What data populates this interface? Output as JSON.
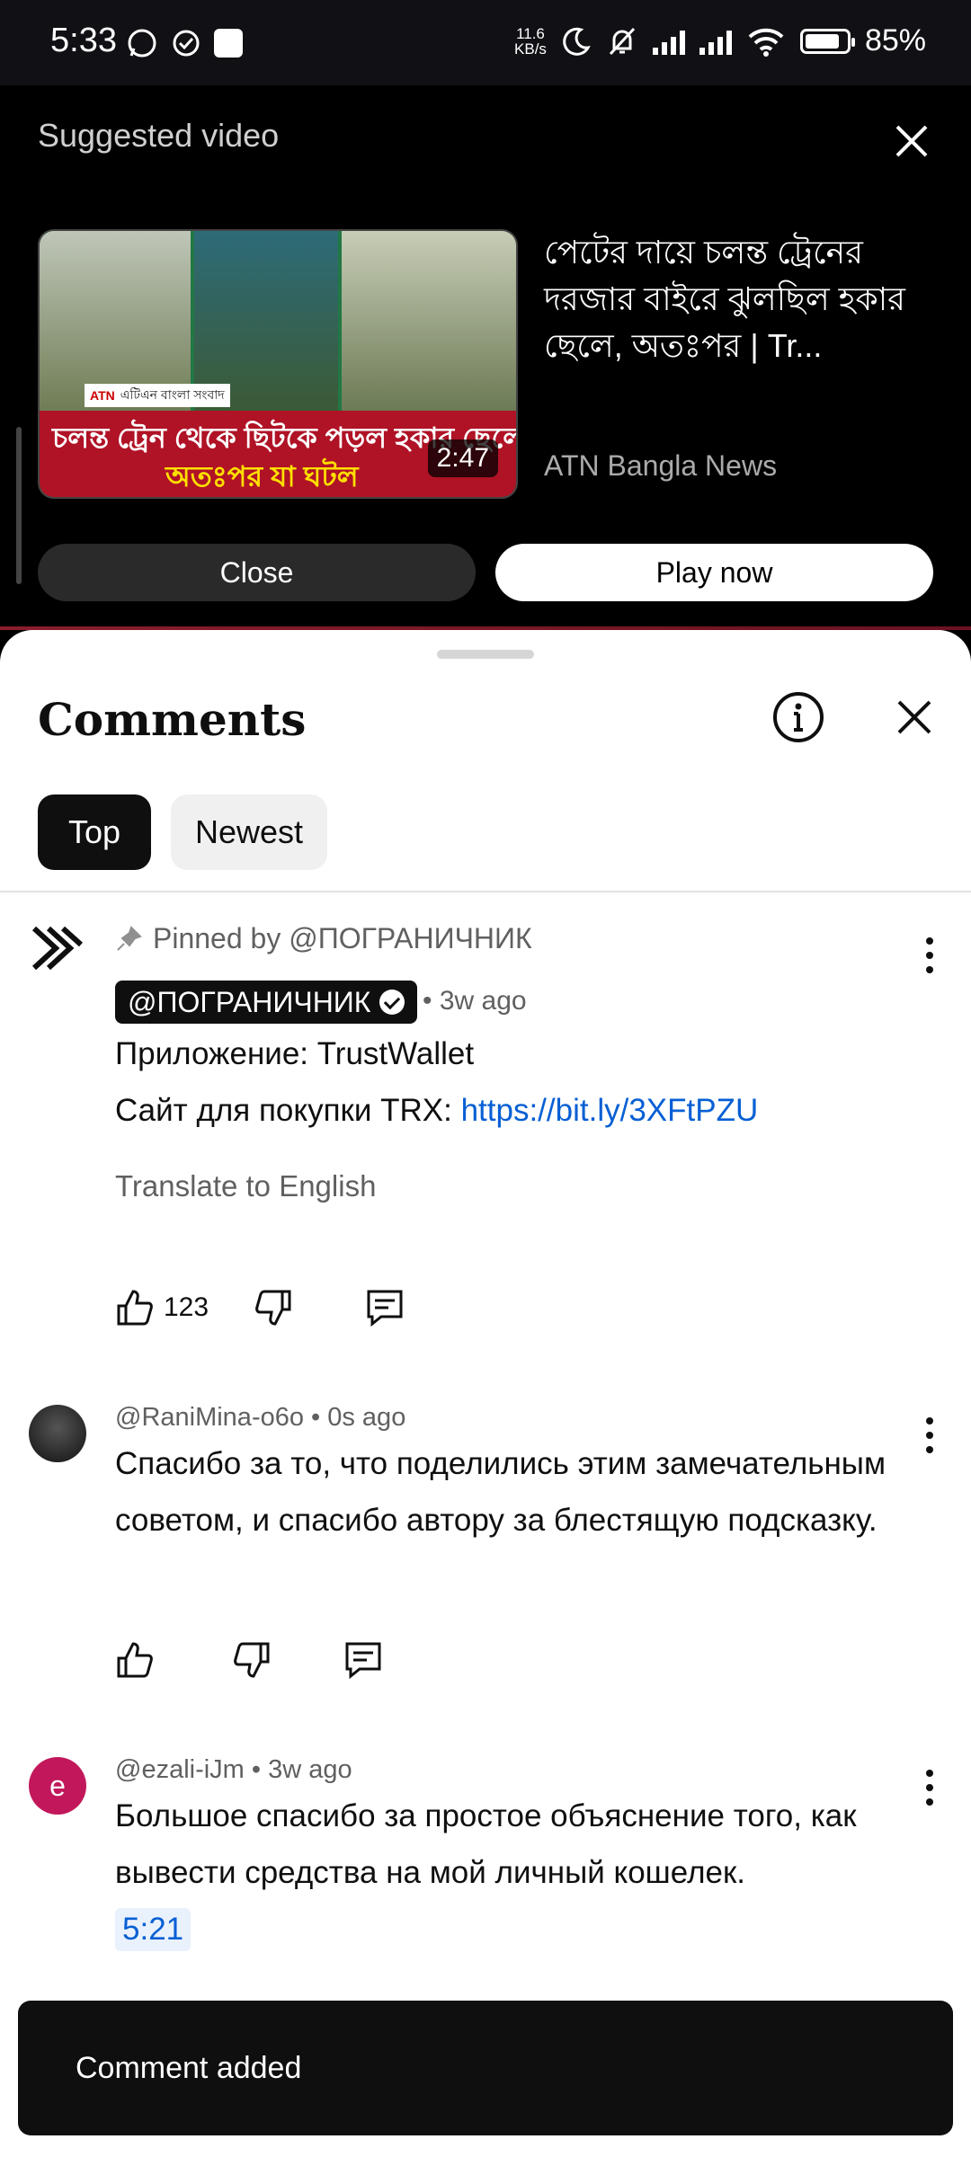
{
  "status_bar": {
    "time": "5:33",
    "net_speed_top": "11.6",
    "net_speed_bottom": "KB/s",
    "battery": "85%",
    "battery_level": 0.85
  },
  "suggested": {
    "header": "Suggested video",
    "video_title": "পেটের দায়ে চলন্ত ট্রেনের দরজার বাইরে ঝুলছিল হকার ছেলে, অতঃপর | Tr...",
    "channel": "ATN Bangla News",
    "thumb_logo": "ATN",
    "thumb_logo_sub": "এটিএন বাংলা সংবাদ",
    "thumb_line1": "চলন্ত ট্রেন থেকে ছিটকে পড়ল হকার ছেলে",
    "thumb_line2": "অতঃপর যা ঘটল",
    "duration": "2:47",
    "close_label": "Close",
    "play_label": "Play now"
  },
  "comments": {
    "title": "Comments",
    "tabs": [
      "Top",
      "Newest"
    ],
    "items": [
      {
        "pinned_by": "Pinned by @ПОГРАНИЧНИК",
        "author": "@ПОГРАНИЧНИК",
        "ago": "• 3w ago",
        "line1": "Приложение: TrustWallet",
        "line2_prefix": "Сайт для покупки TRX: ",
        "line2_link": "https://bit.ly/3XFtPZU",
        "translate": "Translate to English",
        "likes": "123"
      },
      {
        "meta": "@RaniMina-o6o • 0s ago",
        "text": "Спасибо за то, что поделились этим замечательным советом, и спасибо автору за блестящую подсказку."
      },
      {
        "avatar_letter": "e",
        "meta": "@ezali-iJm • 3w ago",
        "text": "Большое спасибо за простое объяснение того, как вывести средства на мой личный кошелек.",
        "timestamp_link": "5:21"
      }
    ]
  },
  "toast": {
    "text": "Comment added"
  },
  "colors": {
    "link": "#065fd4",
    "sheet_bg": "#ffffff",
    "avatar_e": "#c2185b"
  }
}
